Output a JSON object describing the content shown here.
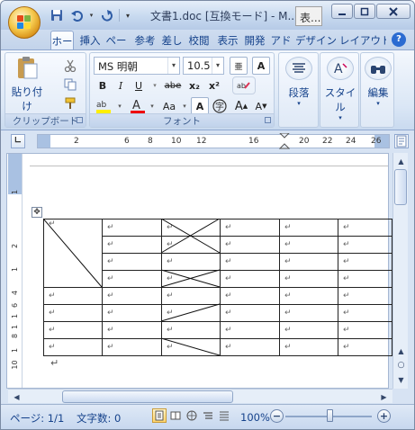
{
  "window": {
    "title": "文書1.doc [互換モード] - M...",
    "tooltip": "表..."
  },
  "tabs": [
    {
      "label": "ホー",
      "active": true
    },
    {
      "label": "挿入"
    },
    {
      "label": "ペー"
    },
    {
      "label": "参考"
    },
    {
      "label": "差し"
    },
    {
      "label": "校閲"
    },
    {
      "label": "表示"
    },
    {
      "label": "開発"
    },
    {
      "label": "アド"
    },
    {
      "label": "デザイン"
    },
    {
      "label": "レイアウト"
    }
  ],
  "ribbon": {
    "clipboard": {
      "paste": "貼り付け",
      "group": "クリップボード"
    },
    "font": {
      "name": "MS 明朝",
      "size": "10.5",
      "group": "フォント",
      "bold": "B",
      "italic": "I",
      "underline": "U",
      "strike": "abe",
      "sub": "x₂",
      "sup": "x²",
      "aa": "Aa",
      "grow": "A",
      "shrink": "A"
    },
    "paragraph": {
      "label": "段落"
    },
    "style": {
      "label": "スタイル"
    },
    "edit": {
      "label": "編集"
    }
  },
  "ruler": {
    "ticks": [
      "2",
      "6",
      "8",
      "10",
      "12",
      "16",
      "20",
      "22",
      "24",
      "26"
    ],
    "vticks": [
      "1",
      "2",
      "1",
      "4",
      "1",
      "6",
      "1",
      "8",
      "1",
      "10"
    ]
  },
  "document": {
    "para_mark": "↵"
  },
  "status": {
    "page": "ページ: 1/1",
    "words": "文字数: 0",
    "zoom": "100%"
  },
  "colors": {
    "accent": "#15428b",
    "ribbon": "#dbe7f6"
  }
}
